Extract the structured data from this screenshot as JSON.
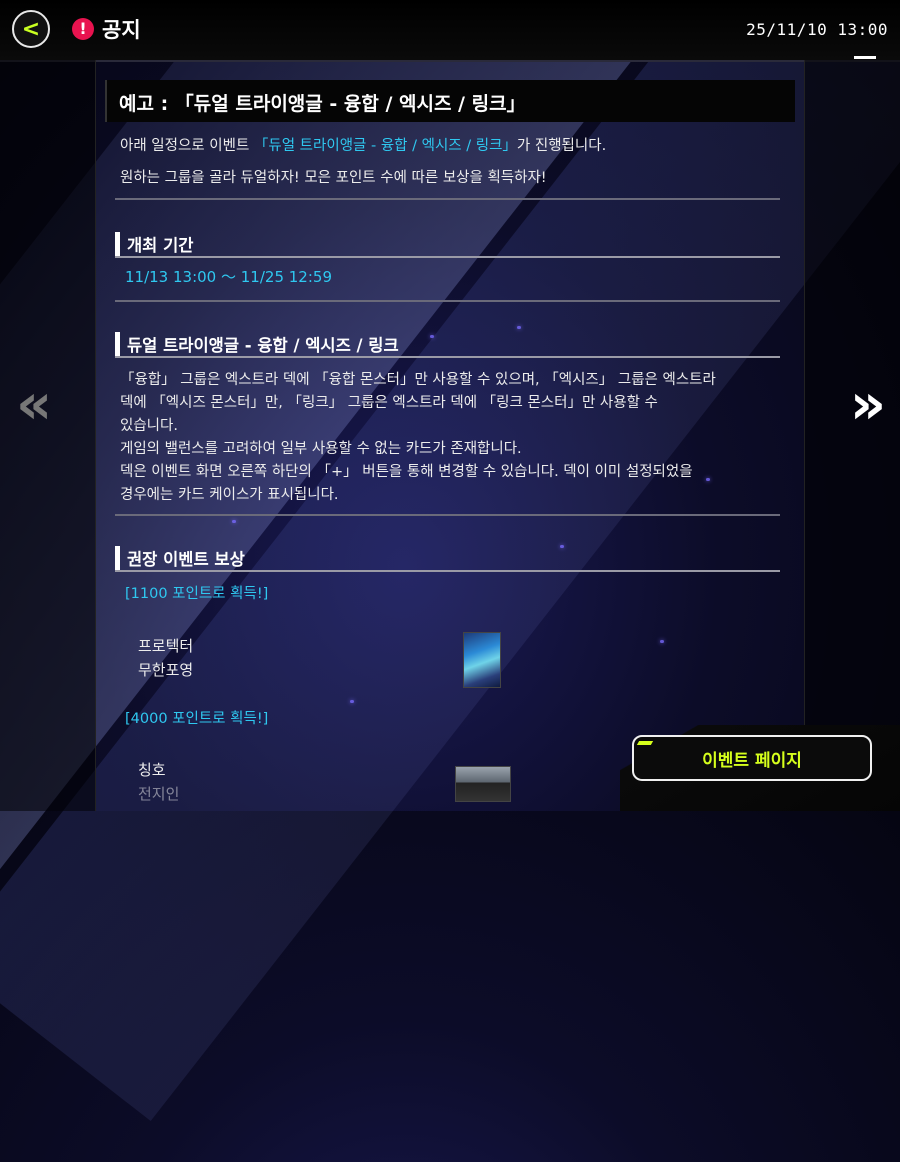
{
  "header": {
    "back_label": "<",
    "notice_icon_glyph": "!",
    "title": "공지",
    "datetime": "25/11/10 13:00"
  },
  "nav": {
    "prev_arrow": "«",
    "next_arrow": "»"
  },
  "notice": {
    "banner_title": "예고 : 「듀얼 트라이앵글 - 융합 / 엑시즈 / 링크」",
    "intro_prefix": "아래 일정으로 이벤트 ",
    "intro_highlight": "「듀얼 트라이앵글 - 융합 / 엑시즈 / 링크」",
    "intro_suffix": "가 진행됩니다.",
    "intro_line2": "원하는 그룹을 골라 듀얼하자! 모은 포인트 수에 따른 보상을 획득하자!",
    "period_heading": "개최 기간",
    "period_value": "11/13 13:00 ～ 11/25 12:59",
    "rules_heading": "듀얼 트라이앵글 - 융합 / 엑시즈 / 링크",
    "rules_lines": [
      "「융합」 그룹은 엑스트라 덱에 「융합 몬스터」만 사용할 수 있으며, 「엑시즈」 그룹은 엑스트라",
      "덱에 「엑시즈 몬스터」만, 「링크」 그룹은 엑스트라 덱에 「링크 몬스터」만 사용할 수",
      "있습니다.",
      "게임의 밸런스를 고려하여 일부 사용할 수 없는 카드가 존재합니다.",
      "덱은 이벤트 화면 오른쪽 하단의 「+」 버튼을 통해 변경할 수 있습니다. 덱이 이미 설정되었을",
      "경우에는 카드 케이스가 표시됩니다."
    ],
    "rewards_heading": "권장 이벤트 보상",
    "rewards": [
      {
        "threshold_label": "[1100 포인트로 획득!]",
        "name_line1": "프로텍터",
        "name_line2": "무한포영",
        "icon": "protector-card-image"
      },
      {
        "threshold_label": "[4000 포인트로 획득!]",
        "name_line1": "칭호",
        "name_line2": "전지인",
        "icon": "title-badge-image"
      }
    ]
  },
  "footer": {
    "event_page_label": "이벤트 페이지"
  },
  "colors": {
    "accent": "#d6ff1c",
    "highlight": "#2fc8f0",
    "notice_red": "#e8134f"
  }
}
